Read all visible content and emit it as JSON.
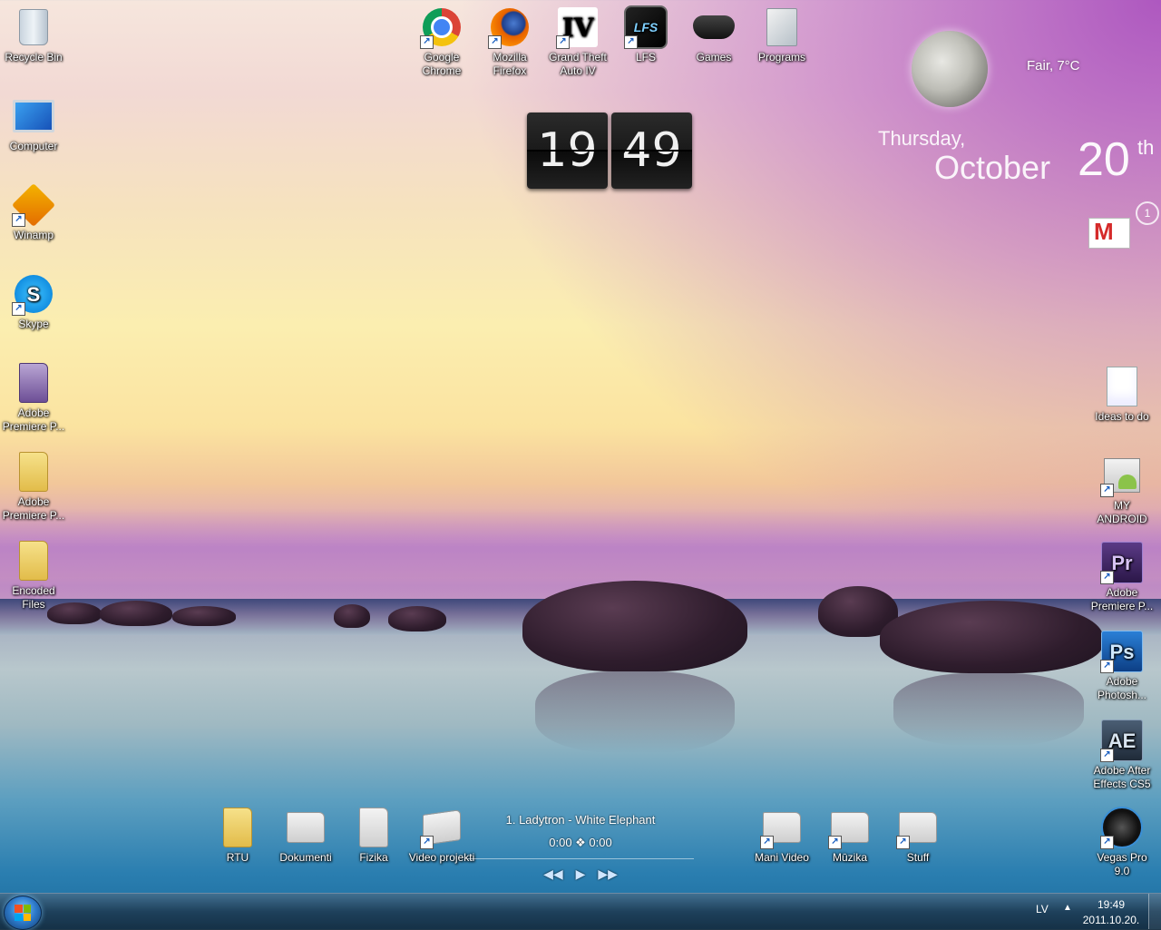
{
  "desktop": {
    "left_icons": [
      {
        "name": "recycle-bin",
        "label": "Recycle Bin"
      },
      {
        "name": "computer",
        "label": "Computer"
      },
      {
        "name": "winamp",
        "label": "Winamp"
      },
      {
        "name": "skype",
        "label": "Skype"
      },
      {
        "name": "adobe-premiere-folder-1",
        "label": "Adobe Premiere P..."
      },
      {
        "name": "adobe-premiere-folder-2",
        "label": "Adobe Premiere P..."
      },
      {
        "name": "encoded-files",
        "label": "Encoded Files"
      }
    ],
    "top_icons": [
      {
        "name": "google-chrome",
        "label": "Google Chrome"
      },
      {
        "name": "mozilla-firefox",
        "label": "Mozilla Firefox"
      },
      {
        "name": "gta-iv",
        "label": "Grand Theft Auto IV"
      },
      {
        "name": "lfs",
        "label": "LFS"
      },
      {
        "name": "games",
        "label": "Games"
      },
      {
        "name": "programs",
        "label": "Programs"
      }
    ],
    "right_icons": [
      {
        "name": "ideas-to-do",
        "label": "Ideas to do"
      },
      {
        "name": "my-android",
        "label": "MY ANDROID"
      },
      {
        "name": "adobe-premiere",
        "label": "Adobe Premiere P..."
      },
      {
        "name": "adobe-photoshop",
        "label": "Adobe Photosh..."
      },
      {
        "name": "adobe-after-effects",
        "label": "Adobe After Effects CS5"
      },
      {
        "name": "vegas-pro",
        "label": "Vegas Pro 9.0"
      }
    ],
    "bottom_icons": [
      {
        "name": "rtu",
        "label": "RTU"
      },
      {
        "name": "dokumenti",
        "label": "Dokumenti"
      },
      {
        "name": "fizika",
        "label": "Fizika"
      },
      {
        "name": "video-projekti",
        "label": "Video projekti"
      },
      {
        "name": "mani-video",
        "label": "Mani Video"
      },
      {
        "name": "muzika",
        "label": "Mūzika"
      },
      {
        "name": "stuff",
        "label": "Stuff"
      }
    ]
  },
  "app_glyphs": {
    "gta": "IV",
    "lfs": "LFS",
    "premiere": "Pr",
    "photoshop": "Ps",
    "after_effects": "AE",
    "skype": "S"
  },
  "flip_clock": {
    "hours": "19",
    "minutes": "49"
  },
  "weather": {
    "condition": "Fair, 7°C",
    "icon": "moon-icon"
  },
  "date_widget": {
    "weekday": "Thursday,",
    "month": "October",
    "day": "20",
    "suffix": "th"
  },
  "gmail": {
    "unread_count": "1",
    "glyph": "M"
  },
  "media_player": {
    "track": "1. Ladytron - White Elephant",
    "time": "0:00 ❖ 0:00",
    "prev": "◀◀",
    "play": "▶",
    "next": "▶▶"
  },
  "taskbar": {
    "language": "LV",
    "tray_arrow": "▲",
    "time": "19:49",
    "date": "2011.10.20."
  },
  "colors": {
    "taskbar": "#1e3c54",
    "start_orb": "#2c78c8"
  }
}
